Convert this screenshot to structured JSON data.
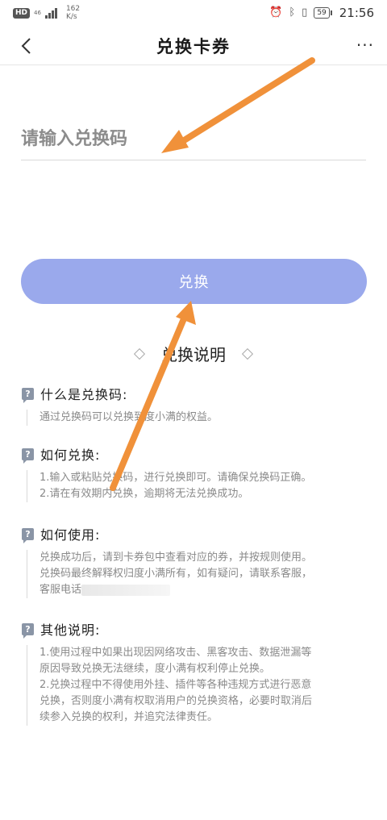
{
  "status_bar": {
    "hd": "HD",
    "network": "46",
    "speed_value": "162",
    "speed_unit": "K/s",
    "battery": "59",
    "time": "21:56"
  },
  "nav": {
    "title": "兑换卡券",
    "more": "···"
  },
  "input": {
    "placeholder": "请输入兑换码"
  },
  "redeem_button": "兑换",
  "section_title": "兑换说明",
  "faq": [
    {
      "title": "什么是兑换码:",
      "lines": [
        "通过兑换码可以兑换到度小满的权益。"
      ]
    },
    {
      "title": "如何兑换:",
      "lines": [
        "1.输入或粘贴兑换码，进行兑换即可。请确保兑换码正确。",
        "2.请在有效期内兑换，逾期将无法兑换成功。"
      ]
    },
    {
      "title": "如何使用:",
      "lines": [
        "兑换成功后，请到卡券包中查看对应的券，并按规则使用。",
        "兑换码最终解释权归度小满所有，如有疑问，请联系客服，",
        "客服电话"
      ]
    },
    {
      "title": "其他说明:",
      "lines": [
        "1.使用过程中如果出现因网络攻击、黑客攻击、数据泄漏等",
        "原因导致兑换无法继续，度小满有权利停止兑换。",
        "2.兑换过程中不得使用外挂、插件等各种违规方式进行恶意",
        "兑换，否则度小满有权取消用户的兑换资格，必要时取消后",
        "续参入兑换的权利，并追究法律责任。"
      ]
    }
  ],
  "colors": {
    "button": "#9aa9ec",
    "arrow": "#f0913a"
  }
}
